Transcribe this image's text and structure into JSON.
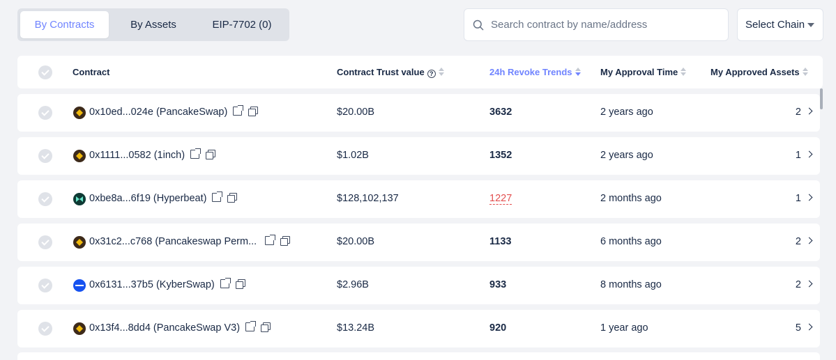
{
  "tabs": [
    {
      "label": "By Contracts",
      "active": true
    },
    {
      "label": "By Assets",
      "active": false
    },
    {
      "label": "EIP-7702 (0)",
      "active": false
    }
  ],
  "search": {
    "placeholder": "Search contract by name/address",
    "icon": "search-icon"
  },
  "chain_select": {
    "label": "Select Chain",
    "icon": "caret-down-icon"
  },
  "table": {
    "headers": {
      "contract": "Contract",
      "trust": "Contract Trust value",
      "trend": "24h Revoke Trends",
      "time": "My Approval Time",
      "assets": "My Approved Assets"
    },
    "rows": [
      {
        "logo": "pancakeswap-logo",
        "contract": "0x10ed...024e (PancakeSwap)",
        "trust": "$20.00B",
        "trend": "3632",
        "trend_highlight": false,
        "time": "2 years ago",
        "assets": "2"
      },
      {
        "logo": "1inch-logo",
        "contract": "0x1111...0582 (1inch)",
        "trust": "$1.02B",
        "trend": "1352",
        "trend_highlight": false,
        "time": "2 years ago",
        "assets": "1"
      },
      {
        "logo": "hyperbeat-logo",
        "contract": "0xbe8a...6f19 (Hyperbeat)",
        "trust": "$128,102,137",
        "trend": "1227",
        "trend_highlight": true,
        "time": "2 months ago",
        "assets": "1"
      },
      {
        "logo": "pancakeswap-logo",
        "contract": "0x31c2...c768 (Pancakeswap Perm...",
        "trust": "$20.00B",
        "trend": "1133",
        "trend_highlight": false,
        "time": "6 months ago",
        "assets": "2"
      },
      {
        "logo": "kyberswap-logo",
        "contract": "0x6131...37b5 (KyberSwap)",
        "trust": "$2.96B",
        "trend": "933",
        "trend_highlight": false,
        "time": "8 months ago",
        "assets": "2"
      },
      {
        "logo": "pancakeswap-logo",
        "contract": "0x13f4...8dd4 (PancakeSwap V3)",
        "trust": "$13.24B",
        "trend": "920",
        "trend_highlight": false,
        "time": "1 year ago",
        "assets": "5"
      }
    ]
  },
  "colors": {
    "accent": "#7084ff",
    "hot": "#e34f4f",
    "text": "#192945",
    "background": "#f2f3f6"
  }
}
